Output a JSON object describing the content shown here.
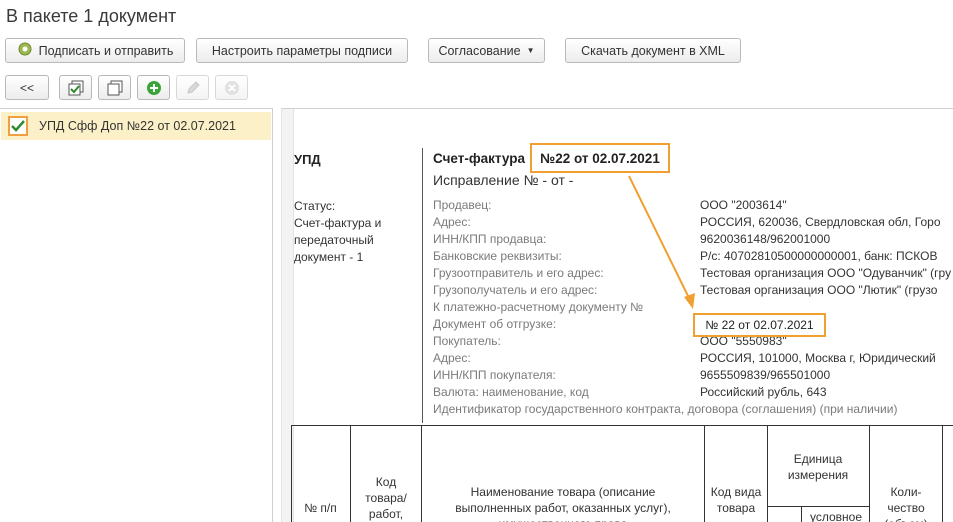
{
  "window": {
    "title": "В пакете 1 документ"
  },
  "toolbar": {
    "sign_send": "Подписать и отправить",
    "sign_params": "Настроить параметры подписи",
    "approval": "Согласование",
    "download_xml": "Скачать документ в XML"
  },
  "subtoolbar": {
    "collapse": "<<"
  },
  "list": {
    "items": [
      {
        "label": "УПД Сфф Доп №22 от 02.07.2021",
        "checked": true
      }
    ]
  },
  "document": {
    "kind": "УПД",
    "status_label": "Статус:",
    "status_value": "Счет-фактура и передаточный документ - 1",
    "invoice_prefix": "Счет-фактура",
    "invoice_number": "№22 от 02.07.2021",
    "correction": "Исправление № - от -",
    "fields": [
      {
        "label": "Продавец:",
        "value": "ООО \"2003614\""
      },
      {
        "label": "Адрес:",
        "value": "РОССИЯ, 620036, Свердловская обл, Горо"
      },
      {
        "label": "ИНН/КПП продавца:",
        "value": "9620036148/962001000"
      },
      {
        "label": "Банковские реквизиты:",
        "value": "Р/с: 40702810500000000001, банк: ПСКОВ"
      },
      {
        "label": "Грузоотправитель и его адрес:",
        "value": "Тестовая организация ООО \"Одуванчик\" (гру"
      },
      {
        "label": "Грузополучатель и его адрес:",
        "value": "Тестовая организация ООО \"Лютик\" (грузо"
      },
      {
        "label": "К платежно-расчетному документу №",
        "value": ""
      },
      {
        "label": "Документ об отгрузке:",
        "value": "№ 22 от 02.07.2021"
      },
      {
        "label": "Покупатель:",
        "value": "ООО \"5550983\""
      },
      {
        "label": "Адрес:",
        "value": "РОССИЯ, 101000, Москва г, Юридический"
      },
      {
        "label": "ИНН/КПП покупателя:",
        "value": "9655509839/965501000"
      },
      {
        "label": "Валюта: наименование, код",
        "value": "Российский рубль, 643"
      },
      {
        "label": "Идентификатор государственного контракта, договора (соглашения) (при наличии)",
        "value": ""
      }
    ],
    "table_headers": {
      "num": "№ п/п",
      "code": "Код товара/ работ,",
      "name": "Наименование товара (описание выполненных работ, оказанных услуг), имущественного права",
      "type_code": "Код вида товара",
      "unit": "Единица измерения",
      "unit_conv": "условное",
      "qty": "Коли- чество (объем)"
    }
  },
  "colors": {
    "highlight": "#f0a030",
    "selected_row": "#fbf0c7"
  }
}
